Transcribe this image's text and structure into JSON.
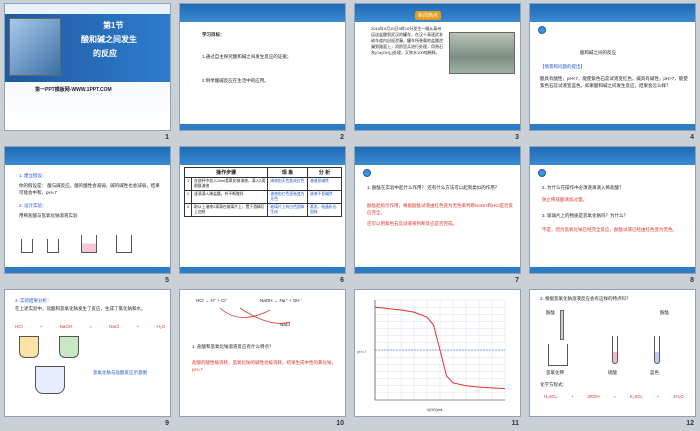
{
  "slides": [
    {
      "n": "1",
      "title1": "第1节",
      "title2": "酸和碱之间发生",
      "title3": "的反应",
      "footer": "第一PPT模板网-WWW.1PPT.COM",
      "header": "课题实验学生实验课《第一章"
    },
    {
      "n": "2",
      "label": "学习目标：",
      "item1": "1.通过自主探究酸和碱之间发生反应的证据；",
      "item2": "2.例举酸碱反应在生活中的应用。"
    },
    {
      "n": "3",
      "tag": "新闻热点",
      "news": "2016年9月10日9时10分发生一辆从泰州运送盐酸到武汉的罐车，在汉十高速武发硫车道内出现泄漏，罐车所装载的盐酸泄漏到路面上，消防官兵进行处理，用熟石灰(Ca(OH)₂)处理，又称水100吨稀释。",
      "red_phrase": "盐酸泄漏",
      "photo": "罐车照片"
    },
    {
      "n": "4",
      "h": "酸和碱之间的反应",
      "q_label": "【情景和问题的提出】",
      "q": "酸具有酸性，pH<7，能使紫色石蕊试液变红色，碱具有碱性，pH>7，能使紫色石蕊试液变蓝色，如果酸和碱之间发生反应，结果会怎么样？",
      "r1": "红",
      "r2": "蓝"
    },
    {
      "n": "5",
      "p1": "1. 建立假设：",
      "p2": "你的假设是：  酸与碱反应，酸的酸性会减弱，碱的碱性也会减弱，结果可能会中和，pH=7",
      "p3": "2. 设计实验：",
      "p4": "用稀盐酸与氢氧化钠溶液实验"
    },
    {
      "n": "6",
      "head": [
        "操作步骤",
        "现 象",
        "分 析"
      ],
      "rows": [
        [
          "1",
          "在烧杯中加入10ml氢氧化钠溶液，滴入2滴酚酞溶液",
          "溶液由无色变成红色",
          "溶液显碱性"
        ],
        [
          "2",
          "逐滴滴入稀盐酸，并不断搅拌",
          "溶液由红色逐渐变为无色",
          "溶液不显碱性"
        ],
        [
          "3",
          "取以上溶液2滴滴在玻璃片上，置于酒精灯上加热",
          "玻璃片上有白色固体生成",
          "蒸发，结晶析出固体"
        ]
      ]
    },
    {
      "n": "7",
      "q1": "1. 酚酞在实验中起什么作用？ 还有什么方法可以起到类似的作用？",
      "a1": "酚酞起指示作用，根据酚酞试液由红色变为无色来判断NaOH和HCl是否反应完全。",
      "a2": "还可以用紫色石蕊试液来判断反应是否完成。"
    },
    {
      "n": "8",
      "q2": "2. 为什么在操作中必须逐滴滴入稀盐酸？",
      "a2": "防止稀盐酸滴加过量。",
      "q3": "3. 玻璃片上的物质是氢氧化钠吗？为什么？",
      "a3": "不是，因为氢氧化钠已经完全反应，酚酞试液已经由红色变为无色。"
    },
    {
      "n": "9",
      "h": "3. 实验结果分析：",
      "t": "在上述实验中，盐酸和氢氧化钠发生了反应，生成了氯化钠和水。",
      "eq": [
        "HCl",
        "+",
        "NaOH",
        "=",
        "NaCl",
        "+",
        "H₂O"
      ],
      "lbl": "氢氧化钠与盐酸反应示意图"
    },
    {
      "n": "10",
      "eq1": "HCl → H⁺ + Cl⁻",
      "eq2": "NaOH → Na⁺ + OH⁻",
      "eq3": "NaCl",
      "q": "1. 盐酸和氢氧化钠溶液反应有什么特点？",
      "a": "盐酸的酸性被消耗，氢氧化钠的碱性也被消耗，结果生成中性的氯化钠，pH=7"
    },
    {
      "n": "11",
      "ylabel": "pH=7",
      "xlabel": "V(HCl)/mL"
    },
    {
      "n": "12",
      "q": "2. 根据氢氧化钠溶液反应会有这样的特点吗？",
      "lbl1": "酚酞",
      "lbl2": "酚酞",
      "lbl3": "氢氧化钾",
      "lbl4": "硫酸",
      "lbl5": "蓝色",
      "eq_label": "化学方程式：",
      "eq": [
        "H₂SO₄",
        "+",
        "2KOH",
        "=",
        "K₂SO₄",
        "+",
        "2H₂O"
      ]
    }
  ],
  "chart_data": {
    "type": "line",
    "title": "",
    "xlabel": "V(HCl)/mL",
    "ylabel": "pH",
    "x": [
      0,
      2,
      4,
      6,
      8,
      9,
      10,
      11,
      12,
      14,
      16,
      18,
      20
    ],
    "y": [
      13,
      12.8,
      12.6,
      12.3,
      11.6,
      10.5,
      7,
      3.4,
      2.4,
      2,
      1.8,
      1.7,
      1.6
    ],
    "reference_line": 7,
    "grid": true
  }
}
